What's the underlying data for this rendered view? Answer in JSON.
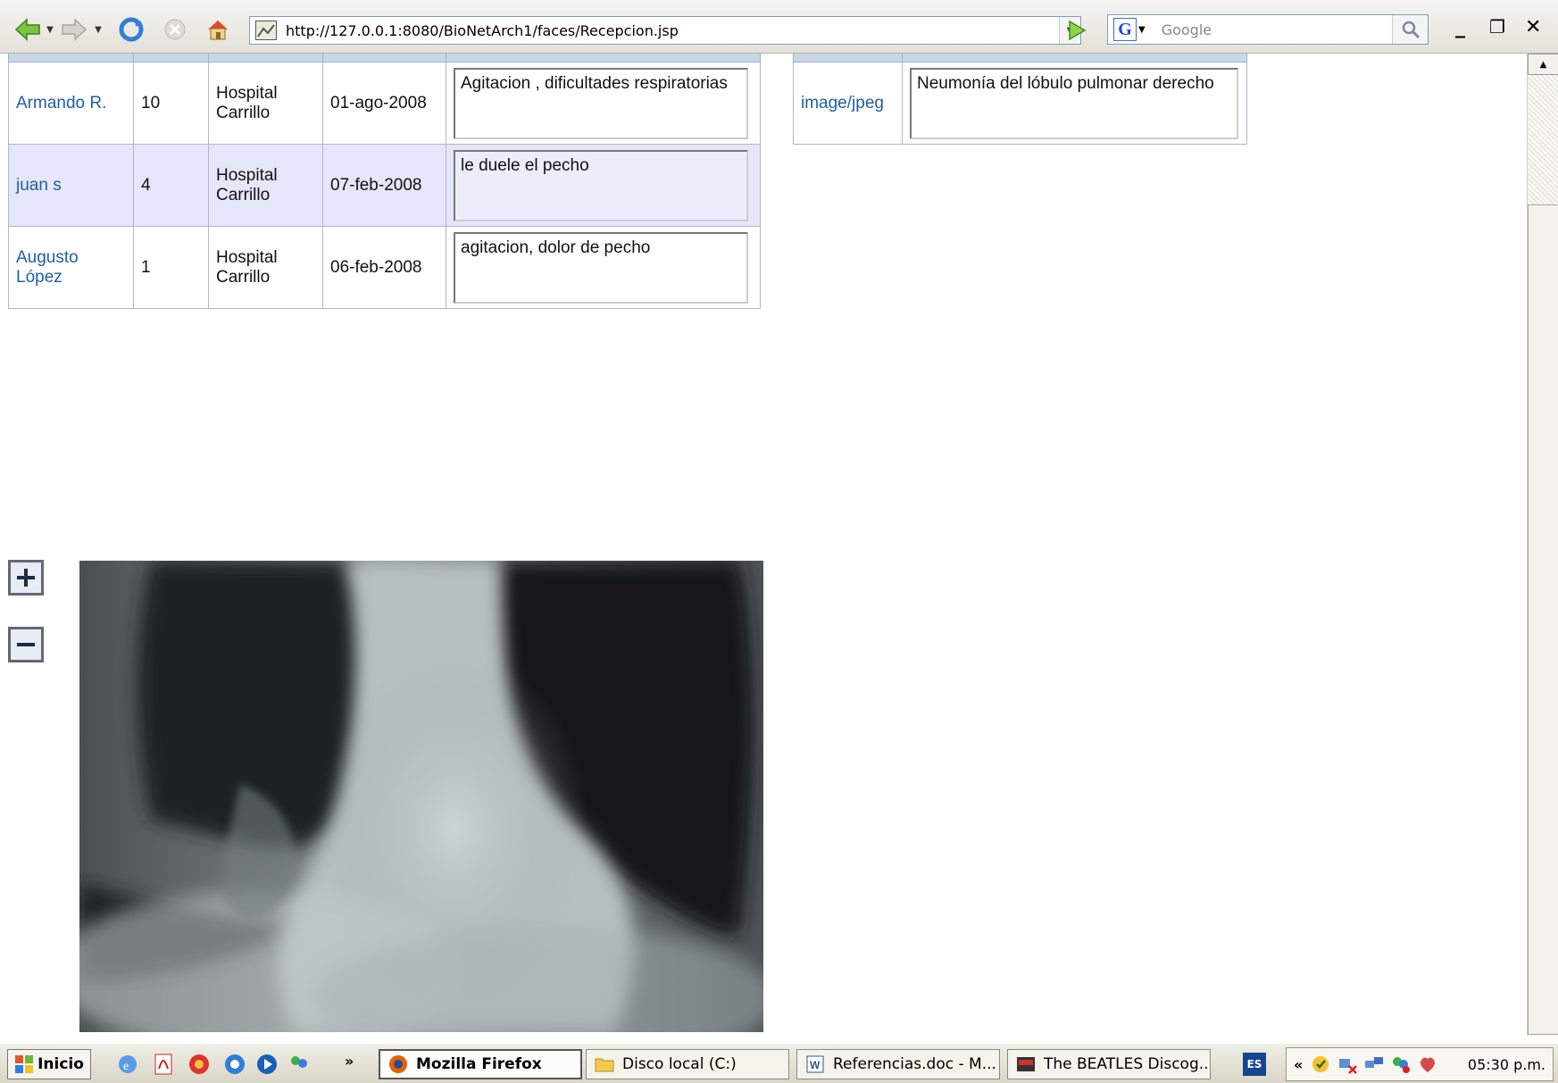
{
  "browser": {
    "url": "http://127.0.0.1:8080/BioNetArch1/faces/Recepcion.jsp",
    "search_placeholder": "Google"
  },
  "patients_table": {
    "rows": [
      {
        "nombre": "Armando R.",
        "n": "10",
        "origen": "Hospital Carrillo",
        "fecha": "01-ago-2008",
        "observaciones": "Agitacion , dificultades respiratorias"
      },
      {
        "nombre": "juan s",
        "n": "4",
        "origen": "Hospital Carrillo",
        "fecha": "07-feb-2008",
        "observaciones": "le duele el pecho"
      },
      {
        "nombre": "Augusto López",
        "n": "1",
        "origen": "Hospital Carrillo",
        "fecha": "06-feb-2008",
        "observaciones": "agitacion, dolor de pecho"
      }
    ]
  },
  "images_table": {
    "rows": [
      {
        "tipo": "image/jpeg",
        "observaciones": "Neumonía del lóbulo pulmonar derecho"
      }
    ]
  },
  "zoom": {
    "in_icon": "zoom-in-icon",
    "out_icon": "zoom-out-icon"
  },
  "taskbar": {
    "start_label": "Inicio",
    "overflow": "»",
    "tasks": [
      "Mozilla Firefox",
      "Disco local (C:)",
      "Referencias.doc - M...",
      "The BEATLES Discog..."
    ],
    "lang": "ES",
    "tray_collapse": "«",
    "clock": "05:30 p.m."
  },
  "colors": {
    "link": "#1f5ea8",
    "alt_row": "#e6e6fb",
    "header": "#c9d8e9",
    "taskbar": "#ece9d8"
  }
}
